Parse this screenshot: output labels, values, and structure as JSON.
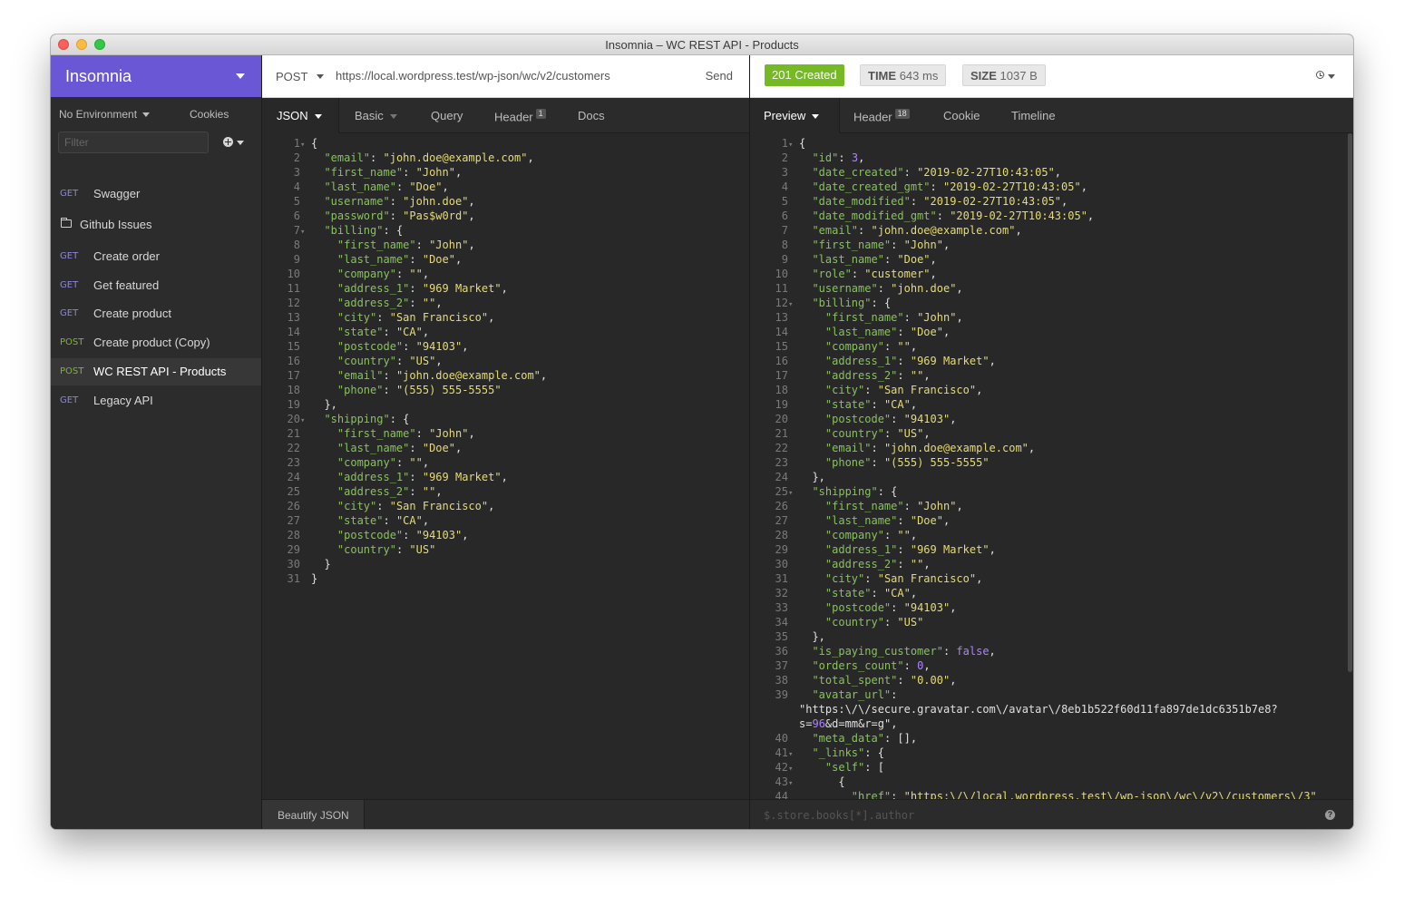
{
  "window": {
    "title": "Insomnia – WC REST API - Products"
  },
  "sidebar": {
    "brand": "Insomnia",
    "environment": "No Environment",
    "cookies": "Cookies",
    "filter_placeholder": "Filter",
    "items": [
      {
        "type": "request",
        "method": "GET",
        "label": "Swagger"
      },
      {
        "type": "folder",
        "label": "Github Issues"
      },
      {
        "type": "request",
        "method": "GET",
        "label": "Create order"
      },
      {
        "type": "request",
        "method": "GET",
        "label": "Get featured"
      },
      {
        "type": "request",
        "method": "GET",
        "label": "Create product"
      },
      {
        "type": "request",
        "method": "POST",
        "label": "Create product (Copy)"
      },
      {
        "type": "request",
        "method": "POST",
        "label": "WC REST API - Products",
        "active": true
      },
      {
        "type": "request",
        "method": "GET",
        "label": "Legacy API"
      }
    ]
  },
  "request": {
    "method": "POST",
    "url": "https://local.wordpress.test/wp-json/wc/v2/customers",
    "send_label": "Send",
    "tabs": [
      {
        "label": "JSON",
        "active": true
      },
      {
        "label": "Basic"
      },
      {
        "label": "Query"
      },
      {
        "label": "Header",
        "badge": "1"
      },
      {
        "label": "Docs"
      }
    ],
    "body_lines": [
      "{",
      "  \"email\": \"john.doe@example.com\",",
      "  \"first_name\": \"John\",",
      "  \"last_name\": \"Doe\",",
      "  \"username\": \"john.doe\",",
      "  \"password\": \"Pas$w0rd\",",
      "  \"billing\": {",
      "    \"first_name\": \"John\",",
      "    \"last_name\": \"Doe\",",
      "    \"company\": \"\",",
      "    \"address_1\": \"969 Market\",",
      "    \"address_2\": \"\",",
      "    \"city\": \"San Francisco\",",
      "    \"state\": \"CA\",",
      "    \"postcode\": \"94103\",",
      "    \"country\": \"US\",",
      "    \"email\": \"john.doe@example.com\",",
      "    \"phone\": \"(555) 555-5555\"",
      "  },",
      "  \"shipping\": {",
      "    \"first_name\": \"John\",",
      "    \"last_name\": \"Doe\",",
      "    \"company\": \"\",",
      "    \"address_1\": \"969 Market\",",
      "    \"address_2\": \"\",",
      "    \"city\": \"San Francisco\",",
      "    \"state\": \"CA\",",
      "    \"postcode\": \"94103\",",
      "    \"country\": \"US\"",
      "  }",
      "}"
    ],
    "fold_lines": [
      1,
      7,
      20
    ],
    "beautify_label": "Beautify JSON"
  },
  "response": {
    "status": "201 Created",
    "time_label": "TIME",
    "time_value": "643 ms",
    "size_label": "SIZE",
    "size_value": "1037 B",
    "tabs": [
      {
        "label": "Preview",
        "active": true
      },
      {
        "label": "Header",
        "badge": "18"
      },
      {
        "label": "Cookie"
      },
      {
        "label": "Timeline"
      }
    ],
    "body_lines": [
      {
        "n": "1",
        "t": "{"
      },
      {
        "n": "2",
        "t": "  \"id\": 3,"
      },
      {
        "n": "3",
        "t": "  \"date_created\": \"2019-02-27T10:43:05\","
      },
      {
        "n": "4",
        "t": "  \"date_created_gmt\": \"2019-02-27T10:43:05\","
      },
      {
        "n": "5",
        "t": "  \"date_modified\": \"2019-02-27T10:43:05\","
      },
      {
        "n": "6",
        "t": "  \"date_modified_gmt\": \"2019-02-27T10:43:05\","
      },
      {
        "n": "7",
        "t": "  \"email\": \"john.doe@example.com\","
      },
      {
        "n": "8",
        "t": "  \"first_name\": \"John\","
      },
      {
        "n": "9",
        "t": "  \"last_name\": \"Doe\","
      },
      {
        "n": "10",
        "t": "  \"role\": \"customer\","
      },
      {
        "n": "11",
        "t": "  \"username\": \"john.doe\","
      },
      {
        "n": "12",
        "t": "  \"billing\": {"
      },
      {
        "n": "13",
        "t": "    \"first_name\": \"John\","
      },
      {
        "n": "14",
        "t": "    \"last_name\": \"Doe\","
      },
      {
        "n": "15",
        "t": "    \"company\": \"\","
      },
      {
        "n": "16",
        "t": "    \"address_1\": \"969 Market\","
      },
      {
        "n": "17",
        "t": "    \"address_2\": \"\","
      },
      {
        "n": "18",
        "t": "    \"city\": \"San Francisco\","
      },
      {
        "n": "19",
        "t": "    \"state\": \"CA\","
      },
      {
        "n": "20",
        "t": "    \"postcode\": \"94103\","
      },
      {
        "n": "21",
        "t": "    \"country\": \"US\","
      },
      {
        "n": "22",
        "t": "    \"email\": \"john.doe@example.com\","
      },
      {
        "n": "23",
        "t": "    \"phone\": \"(555) 555-5555\""
      },
      {
        "n": "24",
        "t": "  },"
      },
      {
        "n": "25",
        "t": "  \"shipping\": {"
      },
      {
        "n": "26",
        "t": "    \"first_name\": \"John\","
      },
      {
        "n": "27",
        "t": "    \"last_name\": \"Doe\","
      },
      {
        "n": "28",
        "t": "    \"company\": \"\","
      },
      {
        "n": "29",
        "t": "    \"address_1\": \"969 Market\","
      },
      {
        "n": "30",
        "t": "    \"address_2\": \"\","
      },
      {
        "n": "31",
        "t": "    \"city\": \"San Francisco\","
      },
      {
        "n": "32",
        "t": "    \"state\": \"CA\","
      },
      {
        "n": "33",
        "t": "    \"postcode\": \"94103\","
      },
      {
        "n": "34",
        "t": "    \"country\": \"US\""
      },
      {
        "n": "35",
        "t": "  },"
      },
      {
        "n": "36",
        "t": "  \"is_paying_customer\": false,"
      },
      {
        "n": "37",
        "t": "  \"orders_count\": 0,"
      },
      {
        "n": "38",
        "t": "  \"total_spent\": \"0.00\","
      },
      {
        "n": "39",
        "t": "  \"avatar_url\":"
      },
      {
        "n": "",
        "t": "\"https:\\/\\/secure.gravatar.com\\/avatar\\/8eb1b522f60d11fa897de1dc6351b7e8?"
      },
      {
        "n": "",
        "t": "s=96&d=mm&r=g\","
      },
      {
        "n": "40",
        "t": "  \"meta_data\": [],"
      },
      {
        "n": "41",
        "t": "  \"_links\": {"
      },
      {
        "n": "42",
        "t": "    \"self\": ["
      },
      {
        "n": "43",
        "t": "      {"
      },
      {
        "n": "44",
        "t": "        \"href\": \"https:\\/\\/local.wordpress.test\\/wp-json\\/wc\\/v2\\/customers\\/3\""
      }
    ],
    "fold_lines": [
      "1",
      "12",
      "25",
      "41",
      "42",
      "43"
    ],
    "filter_placeholder": "$.store.books[*].author"
  },
  "colors": {
    "brand": "#6a57d5",
    "status_ok": "#75ba24",
    "method_get": "#8e86e0",
    "method_post": "#7fb33f"
  }
}
